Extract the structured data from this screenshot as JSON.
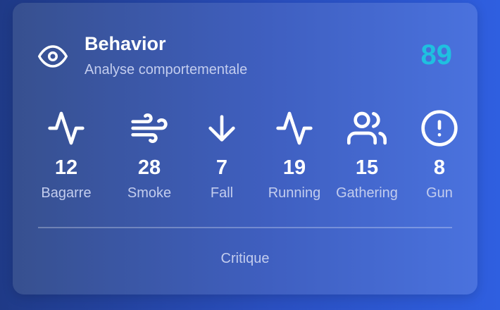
{
  "header": {
    "icon": "eye-icon",
    "title": "Behavior",
    "subtitle": "Analyse comportementale",
    "score": "89",
    "score_color": "#1fc0e0"
  },
  "metrics": [
    {
      "icon": "activity-icon",
      "value": "12",
      "label": "Bagarre"
    },
    {
      "icon": "wind-icon",
      "value": "28",
      "label": "Smoke"
    },
    {
      "icon": "arrow-down-icon",
      "value": "7",
      "label": "Fall"
    },
    {
      "icon": "activity-icon",
      "value": "19",
      "label": "Running"
    },
    {
      "icon": "users-icon",
      "value": "15",
      "label": "Gathering"
    },
    {
      "icon": "alert-circle-icon",
      "value": "8",
      "label": "Gun"
    }
  ],
  "footer": {
    "label": "Critique"
  }
}
